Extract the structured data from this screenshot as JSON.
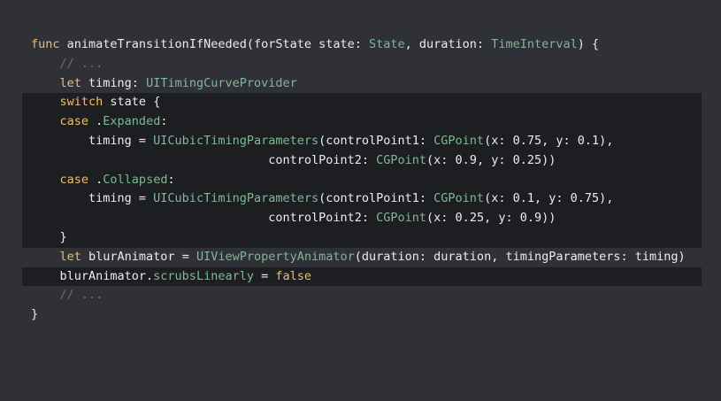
{
  "code": {
    "lines": [
      [
        {
          "t": "func",
          "c": "kw"
        },
        {
          "t": " animateTransitionIfNeeded(forState state: ",
          "c": "nm"
        },
        {
          "t": "State",
          "c": "ty"
        },
        {
          "t": ", duration: ",
          "c": "nm"
        },
        {
          "t": "TimeInterval",
          "c": "ty"
        },
        {
          "t": ") {",
          "c": "nm"
        }
      ],
      [
        {
          "t": "    ",
          "c": "nm"
        },
        {
          "t": "// ...",
          "c": "cm"
        }
      ],
      [
        {
          "t": "    ",
          "c": "nm"
        },
        {
          "t": "let",
          "c": "kw"
        },
        {
          "t": " timing: ",
          "c": "nm"
        },
        {
          "t": "UITimingCurveProvider",
          "c": "ty"
        }
      ],
      [
        {
          "t": "    ",
          "c": "nm"
        },
        {
          "t": "switch",
          "c": "kw"
        },
        {
          "t": " state {",
          "c": "nm"
        }
      ],
      [
        {
          "t": "    ",
          "c": "nm"
        },
        {
          "t": "case",
          "c": "kw"
        },
        {
          "t": " .",
          "c": "nm"
        },
        {
          "t": "Expanded",
          "c": "ty"
        },
        {
          "t": ":",
          "c": "nm"
        }
      ],
      [
        {
          "t": "        timing = ",
          "c": "nm"
        },
        {
          "t": "UICubicTimingParameters",
          "c": "ty"
        },
        {
          "t": "(controlPoint1: ",
          "c": "nm"
        },
        {
          "t": "CGPoint",
          "c": "ty"
        },
        {
          "t": "(x: 0.75, y: 0.1),",
          "c": "nm"
        }
      ],
      [
        {
          "t": "                                 controlPoint2: ",
          "c": "nm"
        },
        {
          "t": "CGPoint",
          "c": "ty"
        },
        {
          "t": "(x: 0.9, y: 0.25))",
          "c": "nm"
        }
      ],
      [
        {
          "t": "    ",
          "c": "nm"
        },
        {
          "t": "case",
          "c": "kw"
        },
        {
          "t": " .",
          "c": "nm"
        },
        {
          "t": "Collapsed",
          "c": "ty"
        },
        {
          "t": ":",
          "c": "nm"
        }
      ],
      [
        {
          "t": "        timing = ",
          "c": "nm"
        },
        {
          "t": "UICubicTimingParameters",
          "c": "ty"
        },
        {
          "t": "(controlPoint1: ",
          "c": "nm"
        },
        {
          "t": "CGPoint",
          "c": "ty"
        },
        {
          "t": "(x: 0.1, y: 0.75),",
          "c": "nm"
        }
      ],
      [
        {
          "t": "                                 controlPoint2: ",
          "c": "nm"
        },
        {
          "t": "CGPoint",
          "c": "ty"
        },
        {
          "t": "(x: 0.25, y: 0.9))",
          "c": "nm"
        }
      ],
      [
        {
          "t": "    }",
          "c": "nm"
        }
      ],
      [
        {
          "t": "    ",
          "c": "nm"
        },
        {
          "t": "let",
          "c": "kw"
        },
        {
          "t": " blurAnimator = ",
          "c": "nm"
        },
        {
          "t": "UIViewPropertyAnimator",
          "c": "ty"
        },
        {
          "t": "(duration: duration, timingParameters: timing)",
          "c": "nm"
        }
      ],
      [
        {
          "t": "    blurAnimator.",
          "c": "nm"
        },
        {
          "t": "scrubsLinearly",
          "c": "ty"
        },
        {
          "t": " = ",
          "c": "nm"
        },
        {
          "t": "false",
          "c": "kw"
        }
      ],
      [
        {
          "t": "    ",
          "c": "nm"
        },
        {
          "t": "// ...",
          "c": "cm"
        }
      ],
      [
        {
          "t": "}",
          "c": "nm"
        }
      ]
    ],
    "highlighted_lines": [
      3,
      4,
      5,
      6,
      7,
      8,
      9,
      10,
      12
    ]
  },
  "colors": {
    "background": "#2f3136",
    "highlight": "#1d1e21",
    "keyword": "#f0be6a",
    "type": "#7fb895",
    "comment": "#6e7075",
    "text": "#ececec"
  }
}
